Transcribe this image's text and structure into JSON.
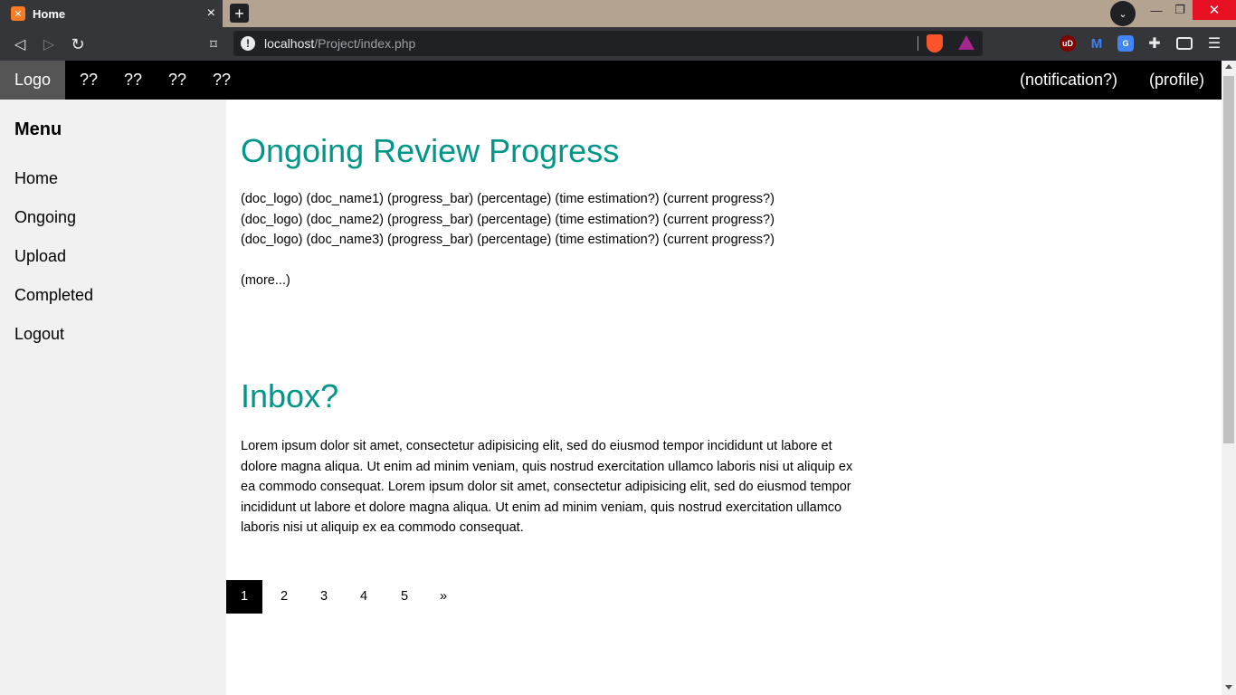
{
  "browser": {
    "tab_title": "Home",
    "tab_close": "×",
    "new_tab": "+",
    "url_host": "localhost",
    "url_path": "/Project/index.php",
    "info_glyph": "!",
    "window_min": "—",
    "window_max": "❐",
    "window_close": "✕",
    "icons": [
      "back-icon",
      "forward-icon",
      "reload-icon",
      "bookmark-icon",
      "info-icon",
      "brave-shields-icon",
      "brave-rewards-icon",
      "ublock-icon",
      "m-extension-icon",
      "translate-icon",
      "extensions-icon",
      "wallet-icon",
      "menu-icon"
    ]
  },
  "topnav": {
    "logo": "Logo",
    "items": [
      "??",
      "??",
      "??",
      "??"
    ],
    "notification": "(notification?)",
    "profile": "(profile)"
  },
  "sidebar": {
    "heading": "Menu",
    "items": [
      "Home",
      "Ongoing",
      "Upload",
      "Completed",
      "Logout"
    ]
  },
  "main": {
    "review_title": "Ongoing Review Progress",
    "docs": [
      "(doc_logo) (doc_name1) (progress_bar) (percentage) (time estimation?) (current progress?)",
      "(doc_logo) (doc_name2) (progress_bar) (percentage) (time estimation?) (current progress?)",
      "(doc_logo) (doc_name3) (progress_bar) (percentage) (time estimation?) (current progress?)"
    ],
    "more": "(more...)",
    "inbox_title": "Inbox?",
    "inbox_text": "Lorem ipsum dolor sit amet, consectetur adipisicing elit, sed do eiusmod tempor incididunt ut labore et dolore magna aliqua. Ut enim ad minim veniam, quis nostrud exercitation ullamco laboris nisi ut aliquip ex ea commodo consequat. Lorem ipsum dolor sit amet, consectetur adipisicing elit, sed do eiusmod tempor incididunt ut labore et dolore magna aliqua. Ut enim ad minim veniam, quis nostrud exercitation ullamco laboris nisi ut aliquip ex ea commodo consequat."
  },
  "pagination": {
    "pages": [
      "1",
      "2",
      "3",
      "4",
      "5"
    ],
    "next": "»",
    "active": "1"
  },
  "colors": {
    "accent": "#009688",
    "nav_bg": "#000000",
    "logo_bg": "#555555",
    "sidebar_bg": "#f1f1f1"
  }
}
